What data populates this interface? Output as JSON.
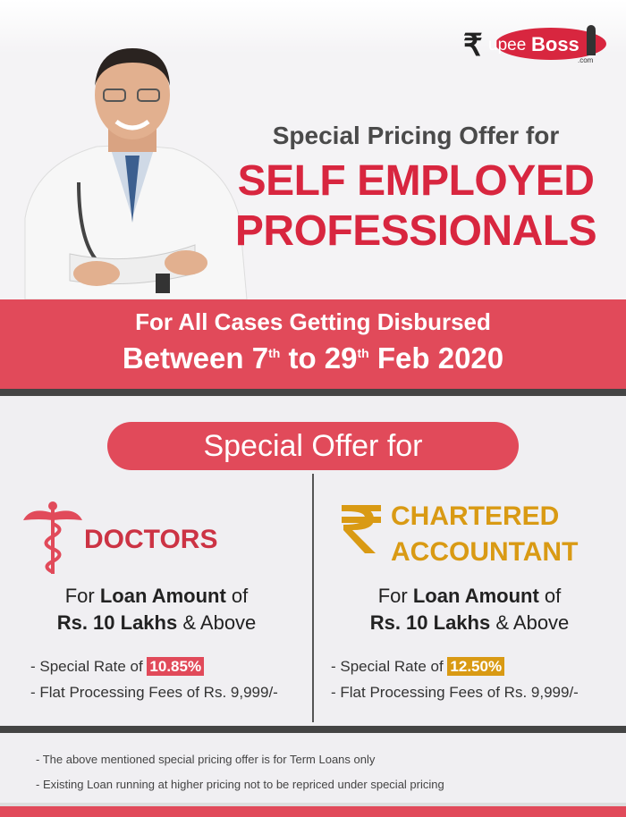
{
  "brand": {
    "logo_r": "₹",
    "logo_upee": "upee",
    "logo_boss": "Boss",
    "logo_com": ".com"
  },
  "headline": {
    "pre": "Special Pricing Offer for",
    "line1": "SELF EMPLOYED",
    "line2": "PROFESSIONALS"
  },
  "banner": {
    "line1": "For All Cases Getting Disbursed",
    "line2_a": "Between 7",
    "sup1": "th",
    "line2_b": " to 29",
    "sup2": "th",
    "line2_c": " Feb 2020"
  },
  "offer_title": "Special Offer for",
  "doctors": {
    "title": "DOCTORS",
    "amount_pre": "For ",
    "amount_bold": "Loan Amount",
    "amount_post": " of",
    "amount_line2_bold": "Rs. 10 Lakhs",
    "amount_line2_post": " & Above",
    "rate_label": "- Special Rate of ",
    "rate_value": "10.85%",
    "fees": "- Flat Processing Fees of Rs. 9,999/-"
  },
  "ca": {
    "title_line1": "CHARTERED",
    "title_line2": "ACCOUNTANT",
    "amount_pre": "For ",
    "amount_bold": "Loan Amount",
    "amount_post": " of",
    "amount_line2_bold": "Rs. 10 Lakhs",
    "amount_line2_post": " & Above",
    "rate_label": "- Special Rate of ",
    "rate_value": "12.50%",
    "fees": "- Flat Processing Fees of Rs. 9,999/-"
  },
  "notes": [
    "- The above mentioned special pricing offer is for Term Loans only",
    "- Existing Loan running at higher pricing not to be repriced under special pricing"
  ],
  "colors": {
    "accent_red": "#e14a5a",
    "headline_red": "#d8263f",
    "gold": "#d99a14",
    "dark_band": "#444444"
  }
}
